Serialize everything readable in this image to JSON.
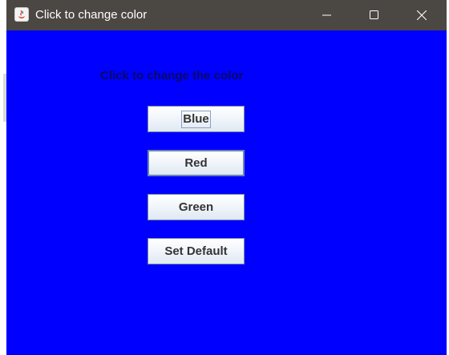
{
  "window": {
    "title": "Click to change color",
    "background_color": "#0000ff",
    "icon": "java-icon",
    "controls": [
      "minimize-icon",
      "maximize-icon",
      "close-icon"
    ]
  },
  "content": {
    "label": "Click to change the color",
    "buttons": [
      {
        "label": "Blue",
        "focused": true
      },
      {
        "label": "Red",
        "focused": false
      },
      {
        "label": "Green",
        "focused": false
      },
      {
        "label": "Set Default",
        "focused": false
      }
    ]
  }
}
